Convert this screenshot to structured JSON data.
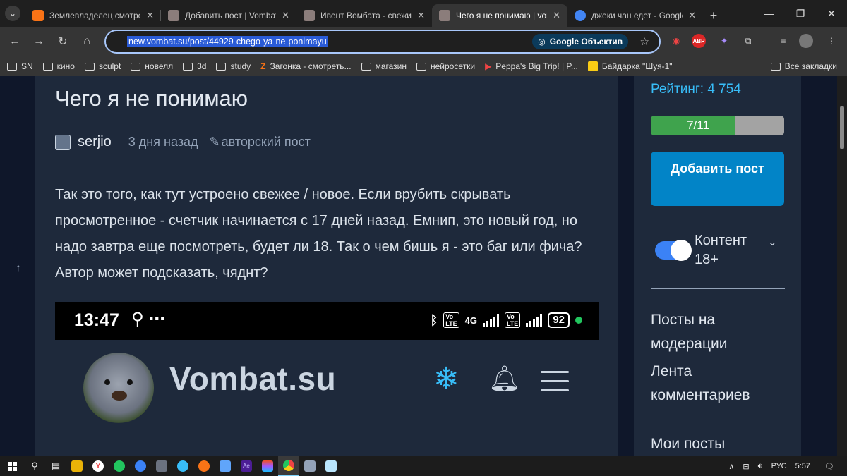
{
  "browser": {
    "tabs": [
      {
        "title": "Землевладелец смотреть",
        "fav_color": "#f97316",
        "active": false
      },
      {
        "title": "Добавить пост | Vombat",
        "fav_color": "#8b7d7b",
        "active": false
      },
      {
        "title": "Ивент Вомбата - свежие",
        "fav_color": "#8b7d7b",
        "active": false
      },
      {
        "title": "Чего я не понимаю | vom",
        "fav_color": "#8b7d7b",
        "active": true
      },
      {
        "title": "джеки чан едет - Google",
        "fav_color": "#4285f4",
        "active": false
      }
    ],
    "url": "new.vombat.su/post/44929-chego-ya-ne-ponimayu",
    "lens_label": "Google Объектив",
    "bookmarks": [
      "SN",
      "кино",
      "sculpt",
      "новелл",
      "3d",
      "study",
      "Загонка - смотреть...",
      "магазин",
      "нейросетки",
      "Peppa's Big Trip! | P...",
      "Байдарка \"Шуя-1\""
    ],
    "all_bookmarks": "Все закладки"
  },
  "post": {
    "title": "Чего я не понимаю",
    "author": "serjio",
    "time_ago": "3 дня назад",
    "post_type": "авторский пост",
    "body": "Так это того, как тут устроено свежее / новое. Если врубить скрывать просмотренное - счетчик начинается с 17 дней назад. Емнип, это новый год, но надо завтра еще посмотреть, будет ли 18. Так о чем бишь я - это баг или фича? Автор может подсказать, чяднт?",
    "embed": {
      "phone_time": "13:47",
      "network": "4G",
      "battery": "92",
      "site_name": "Vombat.su"
    }
  },
  "sidebar": {
    "rating_label": "Рейтинг: 4 754",
    "progress_text": "7/11",
    "progress_fraction": 0.636,
    "add_post_label": "Добавить пост",
    "content_toggle_label": "Контент 18+",
    "links": [
      "Посты на модерации",
      "Лента комментариев",
      "Мои посты"
    ]
  },
  "taskbar": {
    "lang": "РУС",
    "clock": "5:57"
  }
}
